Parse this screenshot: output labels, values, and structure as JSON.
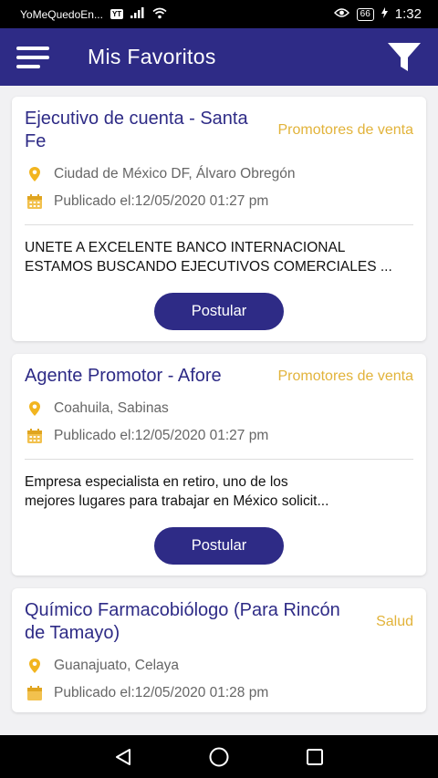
{
  "status_bar": {
    "app_name": "YoMeQuedoEn...",
    "yt_badge": "YouTube",
    "battery": "66",
    "time": "1:32"
  },
  "header": {
    "title": "Mis Favoritos",
    "menu_icon": "hamburger-menu-icon",
    "filter_icon": "filter-funnel-icon"
  },
  "colors": {
    "primary": "#2e2b86",
    "accent": "#e2b33a"
  },
  "jobs": [
    {
      "title": "Ejecutivo de cuenta - Santa Fe",
      "category": "Promotores de venta",
      "location": "Ciudad de México DF, Álvaro Obregón",
      "published": "Publicado el:12/05/2020 01:27 pm",
      "description_line1": "UNETE A EXCELENTE BANCO INTERNACIONAL",
      "description_line2": "ESTAMOS BUSCANDO EJECUTIVOS COMERCIALES ...",
      "button": "Postular"
    },
    {
      "title": "Agente Promotor - Afore",
      "category": "Promotores de venta",
      "location": "Coahuila, Sabinas",
      "published": "Publicado el:12/05/2020 01:27 pm",
      "description_line1": "Empresa especialista en retiro, uno de los",
      "description_line2": "mejores lugares para trabajar en México solicit...",
      "button": "Postular"
    },
    {
      "title": "Químico Farmacobiólogo (Para Rincón de Tamayo)",
      "category": "Salud",
      "location": "Guanajuato, Celaya",
      "published": "Publicado el:12/05/2020 01:28 pm"
    }
  ],
  "nav": {
    "back_icon": "back-triangle-icon",
    "home_icon": "home-circle-icon",
    "recents_icon": "recents-square-icon"
  }
}
